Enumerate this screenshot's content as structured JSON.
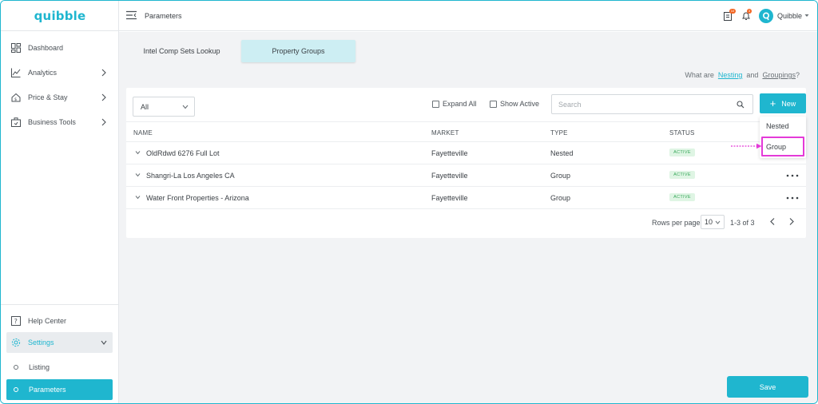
{
  "app": {
    "logo": "quibble",
    "page_title": "Parameters"
  },
  "sidebar": {
    "items": [
      {
        "label": "Dashboard",
        "icon": "dashboard-icon"
      },
      {
        "label": "Analytics",
        "icon": "analytics-icon"
      },
      {
        "label": "Price & Stay",
        "icon": "price-stay-icon"
      },
      {
        "label": "Business Tools",
        "icon": "business-tools-icon"
      }
    ],
    "help_center": "Help Center",
    "settings": "Settings",
    "sub_items": [
      {
        "label": "Listing"
      },
      {
        "label": "Parameters"
      }
    ]
  },
  "header": {
    "notifications_badge": "10",
    "alerts_badge": "3",
    "user_name": "Quibble"
  },
  "tabs": [
    {
      "label": "Intel Comp Sets Lookup"
    },
    {
      "label": "Property Groups"
    }
  ],
  "help_line": {
    "prefix": "What are",
    "nesting": "Nesting",
    "and": "and",
    "groupings": "Groupings",
    "suffix": "?"
  },
  "toolbar": {
    "filter_value": "All",
    "expand_all": "Expand All",
    "show_active": "Show Active",
    "search_placeholder": "Search",
    "new_label": "New"
  },
  "table": {
    "headers": {
      "name": "NAME",
      "market": "MARKET",
      "type": "TYPE",
      "status": "STATUS"
    },
    "rows": [
      {
        "name": "OldRdwd 6276 Full Lot",
        "market": "Fayetteville",
        "type": "Nested",
        "status": "ACTIVE"
      },
      {
        "name": "Shangri-La Los Angeles CA",
        "market": "Fayetteville",
        "type": "Group",
        "status": "ACTIVE"
      },
      {
        "name": "Water Front Properties - Arizona",
        "market": "Fayetteville",
        "type": "Group",
        "status": "ACTIVE"
      }
    ]
  },
  "pagination": {
    "rows_per_page_label": "Rows per page",
    "rows_per_page": "10",
    "range": "1-3 of 3"
  },
  "new_menu": {
    "items": [
      "Nested",
      "Group"
    ]
  },
  "footer": {
    "save_label": "Save"
  },
  "colors": {
    "accent": "#1fb6cf",
    "highlight": "#e43ad8",
    "active_status": "#38a85a"
  }
}
